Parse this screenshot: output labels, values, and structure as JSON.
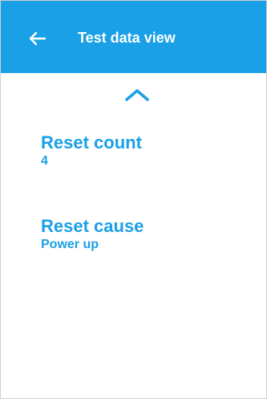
{
  "header": {
    "title": "Test data view",
    "back_icon": "back-arrow-icon"
  },
  "scroll_up_icon": "chevron-up-icon",
  "items": [
    {
      "label": "Reset count",
      "value": "4"
    },
    {
      "label": "Reset cause",
      "value": "Power up"
    }
  ],
  "colors": {
    "accent": "#1aa0e6",
    "header_text": "#ffffff",
    "background": "#ffffff"
  }
}
